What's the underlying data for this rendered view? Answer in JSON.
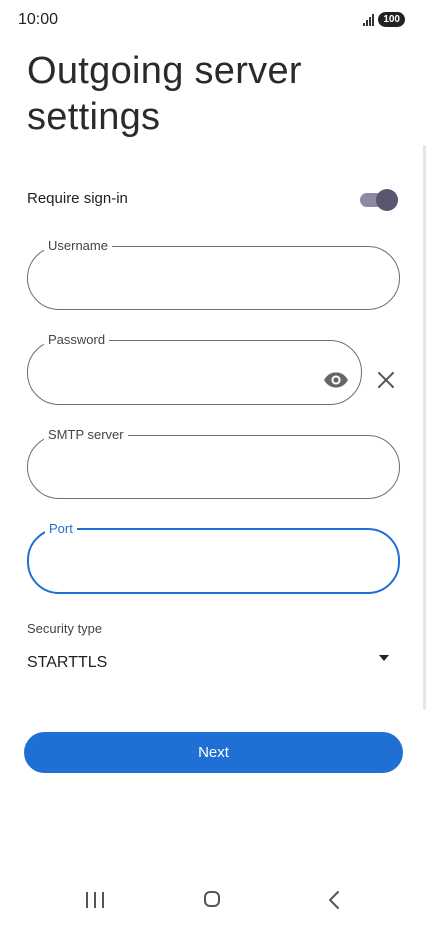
{
  "status_bar": {
    "time": "10:00",
    "battery": "100"
  },
  "page": {
    "title": "Outgoing server settings"
  },
  "require_signin": {
    "label": "Require sign-in",
    "enabled": true
  },
  "fields": {
    "username": {
      "label": "Username",
      "value": "",
      "placeholder": ""
    },
    "password": {
      "label": "Password",
      "value": "",
      "placeholder": ""
    },
    "smtp_server": {
      "label": "SMTP server",
      "value": "",
      "placeholder": ""
    },
    "port": {
      "label": "Port",
      "value": "",
      "placeholder": ""
    }
  },
  "security": {
    "label": "Security type",
    "value": "STARTTLS"
  },
  "actions": {
    "next_label": "Next"
  },
  "icons": {
    "password_visibility": "eye-icon",
    "clear": "close-icon",
    "dropdown": "caret-down-icon",
    "nav_recents": "recents-icon",
    "nav_home": "home-icon",
    "nav_back": "back-icon"
  },
  "colors": {
    "accent": "#1f6fd4",
    "toggle_thumb": "#5a5570",
    "toggle_track": "#8e8aa3"
  }
}
